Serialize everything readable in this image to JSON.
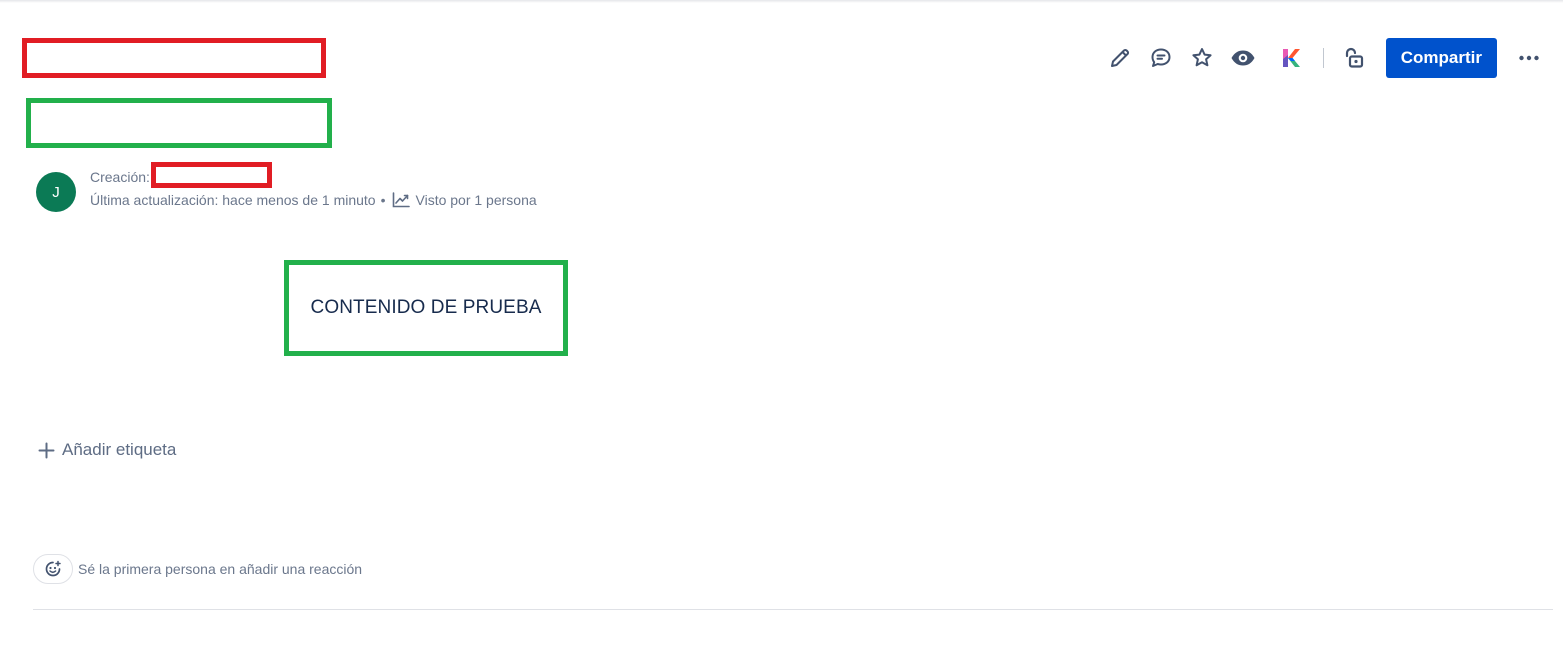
{
  "page": {
    "content_text": "CONTENIDO DE PRUEBA"
  },
  "toolbar": {
    "edit_icon": "pencil-icon",
    "comment_icon": "comment-icon",
    "star_icon": "star-icon",
    "watch_icon": "eye-icon",
    "app_icon": "k-logo-icon",
    "restrictions_icon": "unlock-icon",
    "share_label": "Compartir",
    "more_icon": "more-horizontal-icon"
  },
  "byline": {
    "avatar_initial": "J",
    "created_label": "Creación:",
    "updated_text": "Última actualización: hace menos de 1 minuto",
    "bullet": "•",
    "views_text": "Visto por 1 persona"
  },
  "labels": {
    "add_label": "Añadir etiqueta"
  },
  "reactions": {
    "prompt": "Sé la primera persona en añadir una reacción"
  },
  "colors": {
    "primary": "#0052cc",
    "avatar": "#0b7a55",
    "redaction_red": "#e11d24",
    "redaction_green": "#22b04b"
  }
}
